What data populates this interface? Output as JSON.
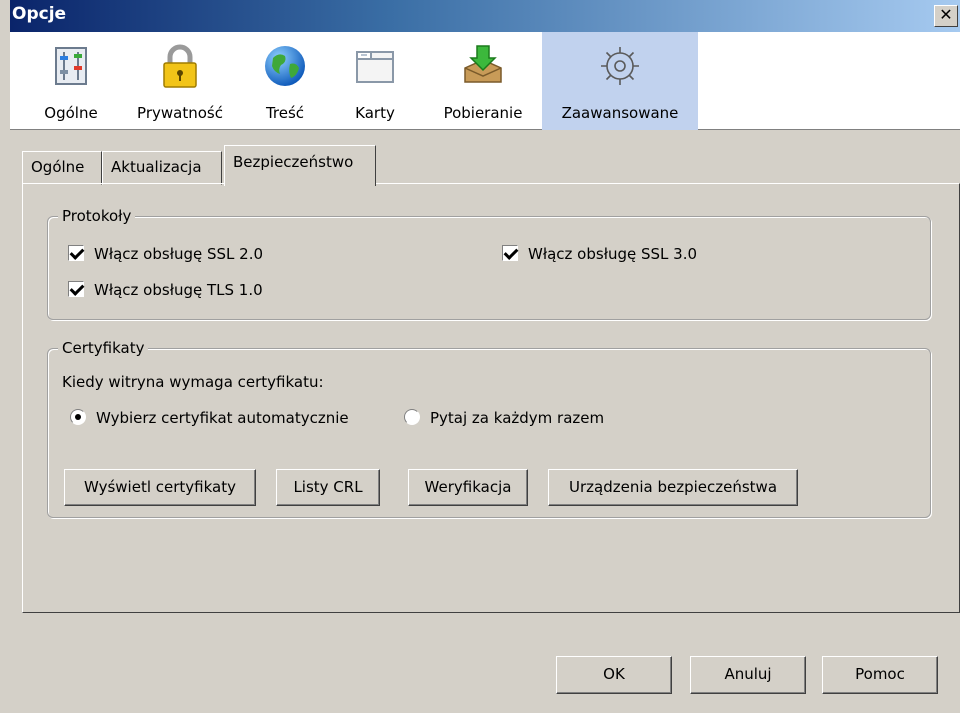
{
  "window": {
    "title": "Opcje",
    "close_label": "✕"
  },
  "toolbar": {
    "items": [
      {
        "label": "Ogólne",
        "icon": "general-icon"
      },
      {
        "label": "Prywatność",
        "icon": "lock-icon"
      },
      {
        "label": "Treść",
        "icon": "globe-icon"
      },
      {
        "label": "Karty",
        "icon": "tabs-icon"
      },
      {
        "label": "Pobieranie",
        "icon": "download-icon"
      },
      {
        "label": "Zaawansowane",
        "icon": "gear-icon",
        "selected": true
      }
    ]
  },
  "tabs": [
    {
      "label": "Ogólne"
    },
    {
      "label": "Aktualizacja"
    },
    {
      "label": "Bezpieczeństwo",
      "active": true
    }
  ],
  "protocols": {
    "legend": "Protokoły",
    "ssl2": {
      "label": "Włącz obsługę SSL 2.0",
      "checked": true
    },
    "ssl3": {
      "label": "Włącz obsługę SSL 3.0",
      "checked": true
    },
    "tls1": {
      "label": "Włącz obsługę TLS 1.0",
      "checked": true
    }
  },
  "certificates": {
    "legend": "Certyfikaty",
    "prompt": "Kiedy witryna wymaga certyfikatu:",
    "radio_auto": {
      "label": "Wybierz certyfikat automatycznie",
      "checked": true
    },
    "radio_ask": {
      "label": "Pytaj za każdym razem",
      "checked": false
    },
    "buttons": {
      "view": "Wyświetl certyfikaty",
      "crl": "Listy CRL",
      "verify": "Weryfikacja",
      "devices": "Urządzenia bezpieczeństwa"
    }
  },
  "footer": {
    "ok": "OK",
    "cancel": "Anuluj",
    "help": "Pomoc"
  },
  "colors": {
    "title_start": "#0a246a",
    "title_end": "#a6caf0",
    "selected_toolbar": "#c1d2ee",
    "face": "#d4d0c8"
  }
}
